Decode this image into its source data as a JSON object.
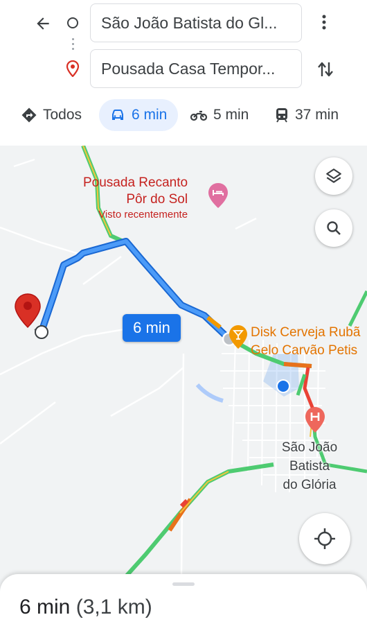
{
  "directions": {
    "origin": "São João Batista do Gl...",
    "destination": "Pousada Casa Tempor..."
  },
  "modes": [
    {
      "label": "Todos",
      "icon": "directions-icon"
    },
    {
      "label": "6 min",
      "icon": "car-icon",
      "selected": true
    },
    {
      "label": "5 min",
      "icon": "motorcycle-icon"
    },
    {
      "label": "37 min",
      "icon": "transit-icon"
    }
  ],
  "map": {
    "poi_pousada": {
      "name_line1": "Pousada Recanto",
      "name_line2": "Pôr do Sol",
      "subtitle": "Visto recentemente"
    },
    "poi_disk": {
      "line1": "Disk Cerveja Rubã",
      "line2": "Gelo Carvão Petis"
    },
    "city_label": [
      "São João",
      "Batista",
      "do Glória"
    ],
    "route_badge": "6 min",
    "colors": {
      "route": "#1a73e8",
      "pin": "#d93025",
      "poi_red": "#c5221f",
      "poi_orange": "#e37400"
    }
  },
  "sheet": {
    "duration": "6 min",
    "distance": "(3,1 km)"
  }
}
